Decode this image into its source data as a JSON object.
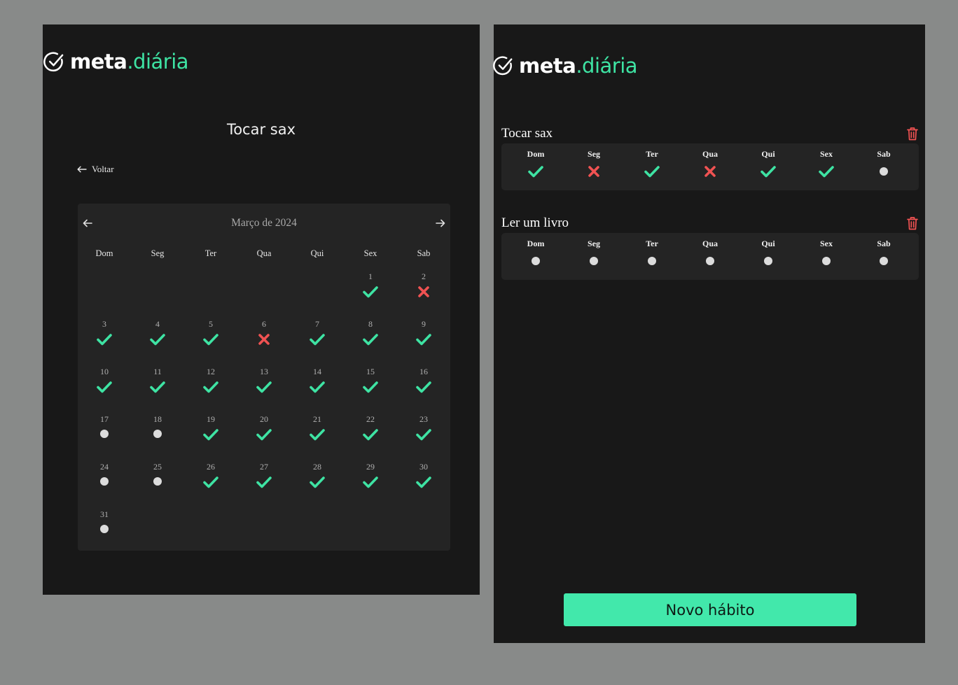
{
  "brand": {
    "word1": "meta",
    "word2": ".diária"
  },
  "colors": {
    "accent": "#3ee3a3",
    "done": "#3ee3a3",
    "missed": "#f05252",
    "pending": "#dcdcdc",
    "panel": "#181818",
    "card": "#242424"
  },
  "detail": {
    "title": "Tocar sax",
    "back_label": "Voltar",
    "calendar": {
      "month_label": "Março de 2024",
      "weekdays": [
        "Dom",
        "Seg",
        "Ter",
        "Qua",
        "Qui",
        "Sex",
        "Sab"
      ],
      "days": [
        {
          "day": "1",
          "status": "done"
        },
        {
          "day": "2",
          "status": "missed"
        },
        {
          "day": "3",
          "status": "done"
        },
        {
          "day": "4",
          "status": "done"
        },
        {
          "day": "5",
          "status": "done"
        },
        {
          "day": "6",
          "status": "missed"
        },
        {
          "day": "7",
          "status": "done"
        },
        {
          "day": "8",
          "status": "done"
        },
        {
          "day": "9",
          "status": "done"
        },
        {
          "day": "10",
          "status": "done"
        },
        {
          "day": "11",
          "status": "done"
        },
        {
          "day": "12",
          "status": "done"
        },
        {
          "day": "13",
          "status": "done"
        },
        {
          "day": "14",
          "status": "done"
        },
        {
          "day": "15",
          "status": "done"
        },
        {
          "day": "16",
          "status": "done"
        },
        {
          "day": "17",
          "status": "pending"
        },
        {
          "day": "18",
          "status": "pending"
        },
        {
          "day": "19",
          "status": "done"
        },
        {
          "day": "20",
          "status": "done"
        },
        {
          "day": "21",
          "status": "done"
        },
        {
          "day": "22",
          "status": "done"
        },
        {
          "day": "23",
          "status": "done"
        },
        {
          "day": "24",
          "status": "pending"
        },
        {
          "day": "25",
          "status": "pending"
        },
        {
          "day": "26",
          "status": "done"
        },
        {
          "day": "27",
          "status": "done"
        },
        {
          "day": "28",
          "status": "done"
        },
        {
          "day": "29",
          "status": "done"
        },
        {
          "day": "30",
          "status": "done"
        },
        {
          "day": "31",
          "status": "pending"
        }
      ]
    }
  },
  "habits": [
    {
      "name": "Tocar sax",
      "week": [
        {
          "label": "Dom",
          "status": "done"
        },
        {
          "label": "Seg",
          "status": "missed"
        },
        {
          "label": "Ter",
          "status": "done"
        },
        {
          "label": "Qua",
          "status": "missed"
        },
        {
          "label": "Qui",
          "status": "done"
        },
        {
          "label": "Sex",
          "status": "done"
        },
        {
          "label": "Sab",
          "status": "pending"
        }
      ]
    },
    {
      "name": "Ler um livro",
      "week": [
        {
          "label": "Dom",
          "status": "pending"
        },
        {
          "label": "Seg",
          "status": "pending"
        },
        {
          "label": "Ter",
          "status": "pending"
        },
        {
          "label": "Qua",
          "status": "pending"
        },
        {
          "label": "Qui",
          "status": "pending"
        },
        {
          "label": "Sex",
          "status": "pending"
        },
        {
          "label": "Sab",
          "status": "pending"
        }
      ]
    }
  ],
  "new_habit_label": "Novo hábito"
}
